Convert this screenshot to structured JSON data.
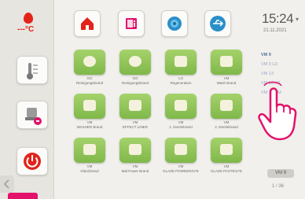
{
  "status": {
    "temperature_unit": "---°C",
    "time": "15:24",
    "date": "21.11.2021"
  },
  "tiles": [
    {
      "caption_line1": "GO",
      "caption_line2": "Reinigungsbrand"
    },
    {
      "caption_line1": "GO",
      "caption_line2": "Reinigungsbrand"
    },
    {
      "caption_line1": "LO",
      "caption_line2": "Regeneration"
    },
    {
      "caption_line1": "VM",
      "caption_line2": "Wash Brand"
    },
    {
      "caption_line1": "VM",
      "caption_line2": "WASHER Brand"
    },
    {
      "caption_line1": "VM",
      "caption_line2": "EFFECT LINER"
    },
    {
      "caption_line1": "VM",
      "caption_line2": "1. Dentinbrand"
    },
    {
      "caption_line1": "VM",
      "caption_line2": "2. Dentinbrand"
    },
    {
      "caption_line1": "VM",
      "caption_line2": "Glanzbrand"
    },
    {
      "caption_line1": "VM",
      "caption_line2": "Mal Power Brand"
    },
    {
      "caption_line1": "VM",
      "caption_line2": "GLAZE POWDER/LFE"
    },
    {
      "caption_line1": "VM",
      "caption_line2": "GLAZE PASTE/LFE"
    }
  ],
  "program_list": {
    "items": [
      "VM 9",
      "VM 9 LD",
      "VM 13",
      "VM 13 LD",
      "VM 13 SM",
      "",
      "",
      "",
      "",
      "",
      "",
      ""
    ],
    "button_label": "VM 9",
    "page": "1 / 36"
  },
  "colors": {
    "accent_red": "#e2231a",
    "tile_green": "#8cc255",
    "list_blue": "#9aa6c8",
    "pink_tab": "#e2126b"
  }
}
